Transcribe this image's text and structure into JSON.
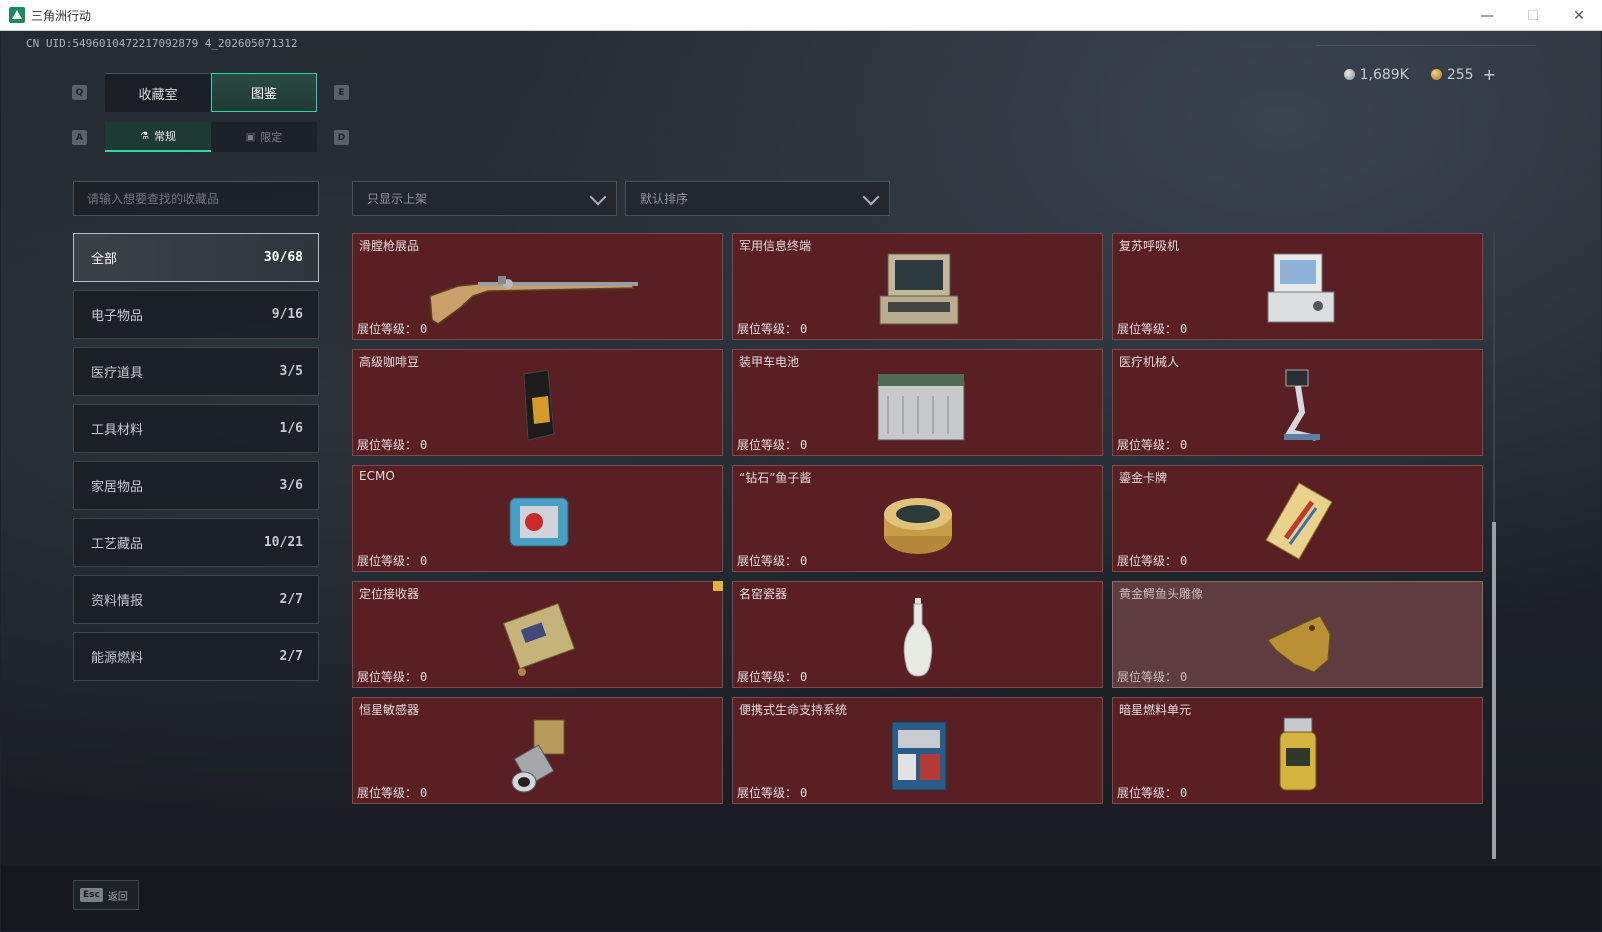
{
  "window": {
    "title": "三角洲行动",
    "minimize": "—",
    "maximize": "☐",
    "close": "✕"
  },
  "uid": "CN UID:5496010472217092879 4_202605071312",
  "currency": {
    "silver": "1,689K",
    "gold": "255",
    "plus": "+"
  },
  "keys": {
    "q": "Q",
    "e": "E",
    "a": "A",
    "d": "D"
  },
  "tabs": [
    {
      "label": "收藏室"
    },
    {
      "label": "图鉴"
    }
  ],
  "subtabs": [
    {
      "label": "常规"
    },
    {
      "label": "限定"
    }
  ],
  "search": {
    "placeholder": "请输入想要查找的收藏品"
  },
  "filters": {
    "shelf": "只显示上架",
    "sort": "默认排序"
  },
  "categories": [
    {
      "label": "全部",
      "count": "30/68"
    },
    {
      "label": "电子物品",
      "count": "9/16"
    },
    {
      "label": "医疗道具",
      "count": "3/5"
    },
    {
      "label": "工具材料",
      "count": "1/6"
    },
    {
      "label": "家居物品",
      "count": "3/6"
    },
    {
      "label": "工艺藏品",
      "count": "10/21"
    },
    {
      "label": "资料情报",
      "count": "2/7"
    },
    {
      "label": "能源燃料",
      "count": "2/7"
    }
  ],
  "level_label": "展位等级：",
  "items": [
    {
      "name": "",
      "level": "0",
      "icon": "none"
    },
    {
      "name": "",
      "level": "0",
      "icon": "none"
    },
    {
      "name": "",
      "level": "0",
      "icon": "none"
    },
    {
      "name": "滑膛枪展品",
      "level": "0",
      "icon": "musket-icon"
    },
    {
      "name": "军用信息终端",
      "level": "0",
      "icon": "terminal-icon"
    },
    {
      "name": "复苏呼吸机",
      "level": "0",
      "icon": "ventilator-icon"
    },
    {
      "name": "高级咖啡豆",
      "level": "0",
      "icon": "coffee-bag-icon"
    },
    {
      "name": "装甲车电池",
      "level": "0",
      "icon": "battery-icon"
    },
    {
      "name": "医疗机械人",
      "level": "0",
      "icon": "medical-robot-icon"
    },
    {
      "name": "ECMO",
      "level": "0",
      "icon": "ecmo-icon"
    },
    {
      "name": "“钻石”鱼子酱",
      "level": "0",
      "icon": "caviar-icon"
    },
    {
      "name": "鎏金卡牌",
      "level": "0",
      "icon": "gilded-card-icon"
    },
    {
      "name": "定位接收器",
      "level": "0",
      "icon": "receiver-icon"
    },
    {
      "name": "名窑瓷器",
      "level": "0",
      "icon": "porcelain-vase-icon"
    },
    {
      "name": "黄金鳄鱼头雕像",
      "level": "0",
      "icon": "gold-crocodile-icon"
    },
    {
      "name": "恒星敏感器",
      "level": "0",
      "icon": "star-sensor-icon"
    },
    {
      "name": "便携式生命支持系统",
      "level": "0",
      "icon": "life-support-icon"
    },
    {
      "name": "暗星燃料单元",
      "level": "0",
      "icon": "fuel-cell-icon"
    }
  ],
  "footer": {
    "esc": "Esc",
    "back": "返回"
  }
}
